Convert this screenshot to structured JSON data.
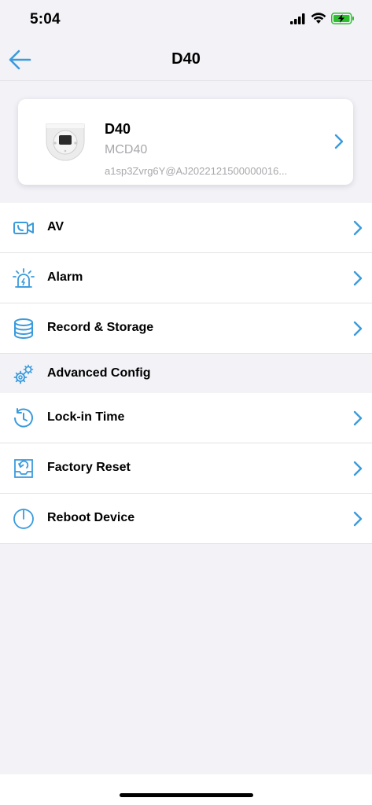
{
  "status_bar": {
    "time": "5:04"
  },
  "nav": {
    "title": "D40"
  },
  "device": {
    "name": "D40",
    "model": "MCD40",
    "id": "a1sp3Zvrg6Y@AJ2022121500000016..."
  },
  "menu": {
    "av": "AV",
    "alarm": "Alarm",
    "record_storage": "Record & Storage",
    "advanced_config": "Advanced Config",
    "lock_in_time": "Lock-in Time",
    "factory_reset": "Factory Reset",
    "reboot_device": "Reboot Device"
  },
  "colors": {
    "accent": "#3A9BDC"
  }
}
